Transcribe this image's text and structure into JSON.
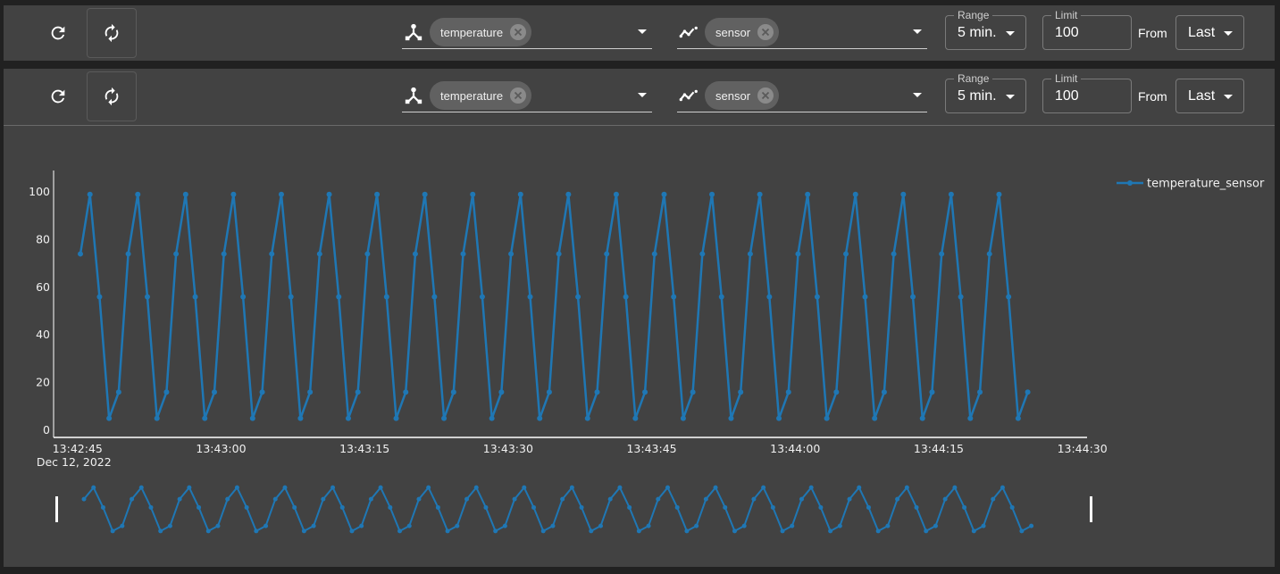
{
  "toolbars": [
    {
      "refresh_icon": "refresh-icon",
      "autorefresh_icon": "autorenew-icon",
      "measurement": {
        "icon": "hub-icon",
        "chip_label": "temperature"
      },
      "field": {
        "icon": "timeline-icon",
        "chip_label": "sensor"
      },
      "range": {
        "label": "Range",
        "value": "5 min."
      },
      "limit": {
        "label": "Limit",
        "value": "100"
      },
      "from": {
        "label": "From",
        "value": "Last"
      }
    },
    {
      "refresh_icon": "refresh-icon",
      "autorefresh_icon": "autorenew-icon",
      "measurement": {
        "icon": "hub-icon",
        "chip_label": "temperature"
      },
      "field": {
        "icon": "timeline-icon",
        "chip_label": "sensor"
      },
      "range": {
        "label": "Range",
        "value": "5 min."
      },
      "limit": {
        "label": "Limit",
        "value": "100"
      },
      "from": {
        "label": "From",
        "value": "Last"
      }
    }
  ],
  "colors": {
    "series": "#1f77b4",
    "panel": "#424242",
    "background": "#212121"
  },
  "chart_data": {
    "type": "line",
    "title": "",
    "xlabel": "",
    "ylabel": "",
    "x_start": "2022-12-12T13:42:45",
    "x_step_seconds": 1,
    "x_first_offset_seconds": 0.3,
    "xlim_seconds": [
      -2.5,
      105.5
    ],
    "x_ticks": [
      {
        "offset": 0,
        "label": "13:42:45",
        "sublabel": "Dec 12, 2022"
      },
      {
        "offset": 15,
        "label": "13:43:00"
      },
      {
        "offset": 30,
        "label": "13:43:15"
      },
      {
        "offset": 45,
        "label": "13:43:30"
      },
      {
        "offset": 60,
        "label": "13:43:45"
      },
      {
        "offset": 75,
        "label": "13:44:00"
      },
      {
        "offset": 90,
        "label": "13:44:15"
      },
      {
        "offset": 105,
        "label": "13:44:30"
      }
    ],
    "ylim": [
      -3,
      109
    ],
    "y_ticks": [
      0,
      20,
      40,
      60,
      80,
      100
    ],
    "grid": false,
    "legend": {
      "position": "top-right",
      "entries": [
        "temperature_sensor"
      ]
    },
    "rangeslider": true,
    "series": [
      {
        "name": "temperature_sensor",
        "pattern_note": "repeating cycle of 5 values",
        "values": [
          74,
          99,
          56,
          5,
          16,
          74,
          99,
          56,
          5,
          16,
          74,
          99,
          56,
          5,
          16,
          74,
          99,
          56,
          5,
          16,
          74,
          99,
          56,
          5,
          16,
          74,
          99,
          56,
          5,
          16,
          74,
          99,
          56,
          5,
          16,
          74,
          99,
          56,
          5,
          16,
          74,
          99,
          56,
          5,
          16,
          74,
          99,
          56,
          5,
          16,
          74,
          99,
          56,
          5,
          16,
          74,
          99,
          56,
          5,
          16,
          74,
          99,
          56,
          5,
          16,
          74,
          99,
          56,
          5,
          16,
          74,
          99,
          56,
          5,
          16,
          74,
          99,
          56,
          5,
          16,
          74,
          99,
          56,
          5,
          16,
          74,
          99,
          56,
          5,
          16,
          74,
          99,
          56,
          5,
          16,
          74,
          99,
          56,
          5,
          16
        ]
      }
    ]
  }
}
